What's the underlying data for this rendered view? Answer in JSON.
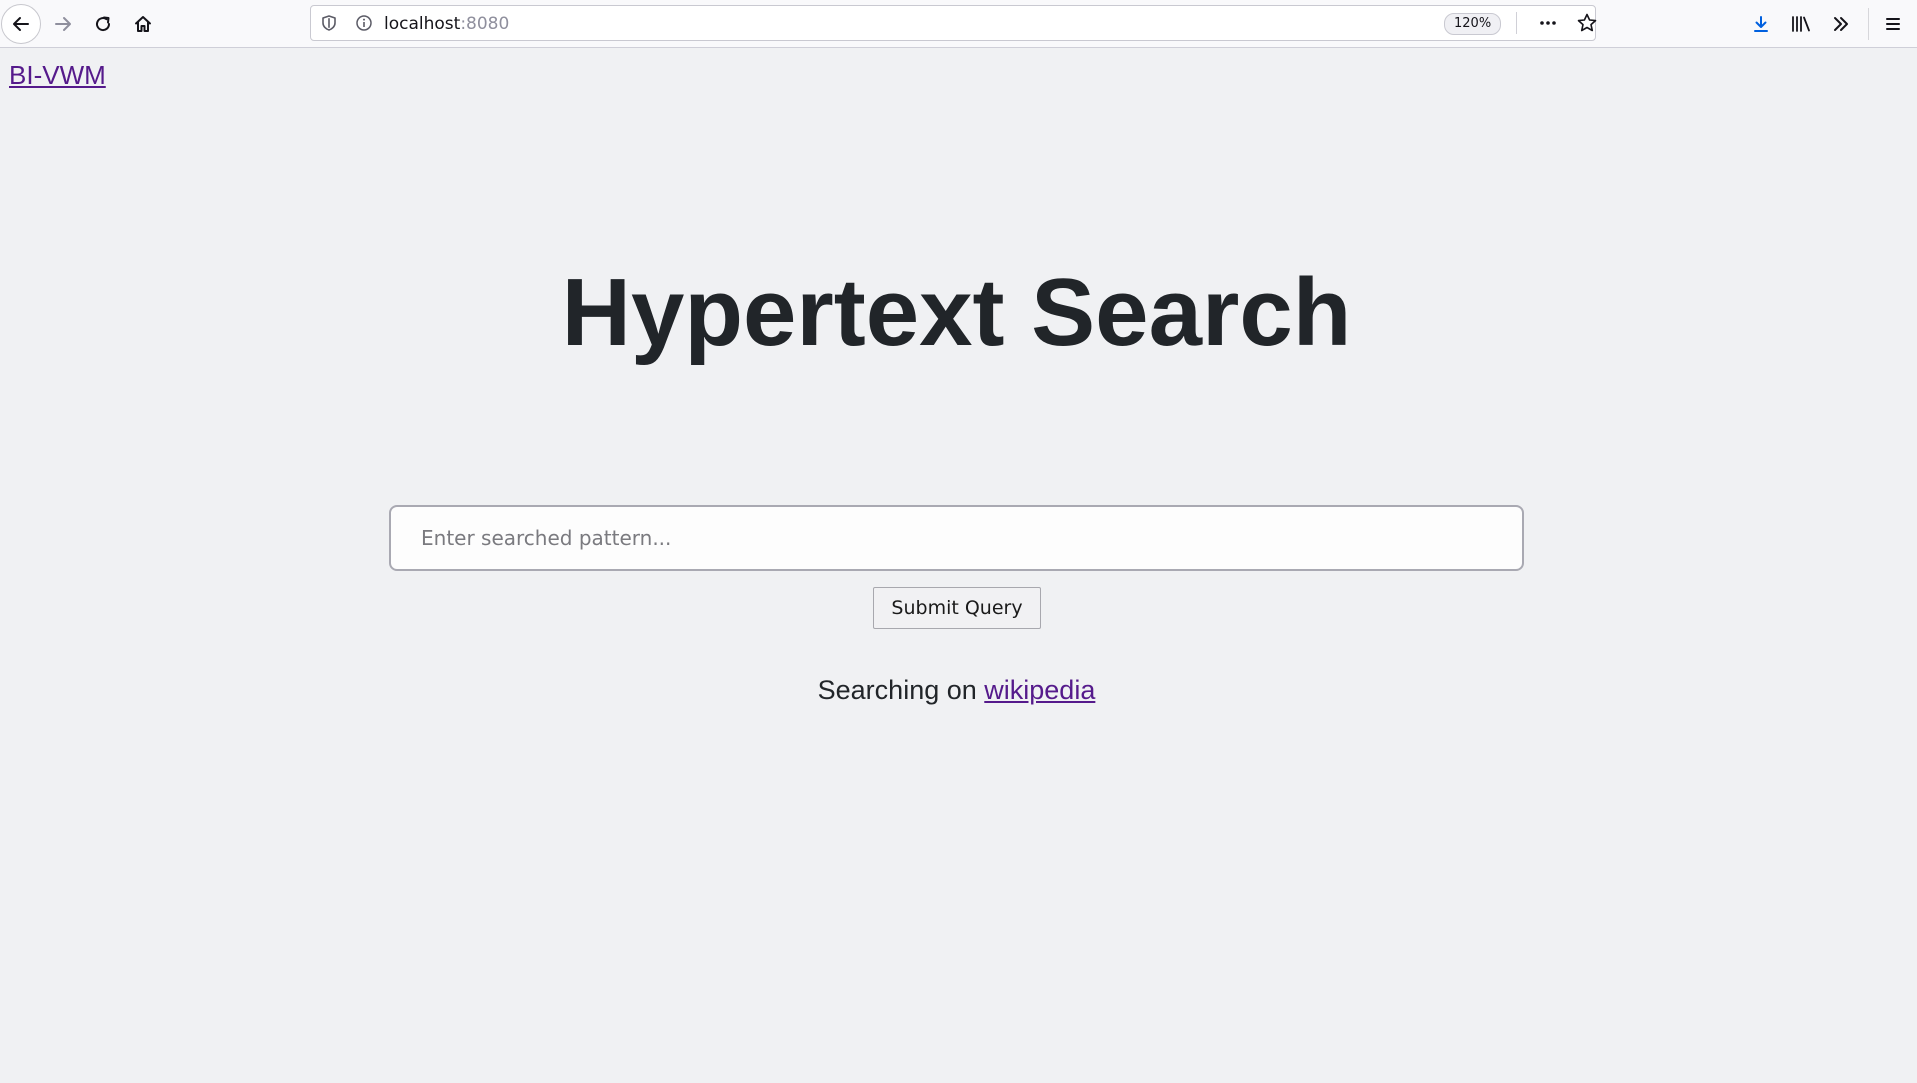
{
  "browser": {
    "url": {
      "host": "localhost",
      "port": ":8080"
    },
    "zoom_label": "120%"
  },
  "page": {
    "site_link": "BI-VWM",
    "title": "Hypertext Search",
    "search": {
      "placeholder": "Enter searched pattern...",
      "value": ""
    },
    "submit_label": "Submit Query",
    "searching_prefix": "Searching on",
    "searching_source": "wikipedia"
  },
  "colors": {
    "background": "#f0f1f3",
    "link_visited": "#551a8b",
    "title_text": "#212529",
    "download_accent": "#0060df"
  },
  "icons": {
    "back": "back-arrow-icon",
    "forward": "forward-arrow-icon",
    "reload": "reload-icon",
    "home": "home-icon",
    "shield": "tracking-shield-icon",
    "info": "info-icon",
    "page_actions": "more-actions-icon",
    "bookmark": "star-icon",
    "download": "download-icon",
    "library": "library-icon",
    "overflow": "overflow-chevron-icon",
    "menu": "hamburger-menu-icon"
  }
}
